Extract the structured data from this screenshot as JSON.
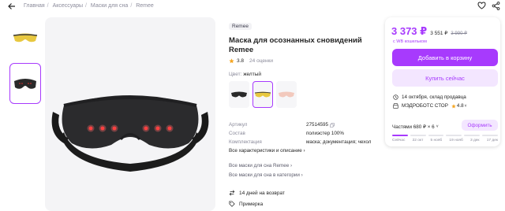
{
  "breadcrumbs": [
    "Главная",
    "Аксессуары",
    "Маски для сна",
    "Remee"
  ],
  "product": {
    "brand": "Remee",
    "title": "Маска для осознанных сновидений Remee",
    "rating": "3.8",
    "reviews": "24 оценки",
    "color_label": "Цвет:",
    "color_value": "желтый"
  },
  "specs": [
    {
      "key": "Артикул",
      "value": "27514595"
    },
    {
      "key": "Состав",
      "value": "полиэстер 100%"
    },
    {
      "key": "Комплектация",
      "value": "маска; документация; чехол"
    }
  ],
  "all_specs_label": "Все характеристики и описание",
  "links": [
    "Все маски для сна Remee",
    "Все маски для сна в категории"
  ],
  "return_label": "14 дней на возврат",
  "fitting_label": "Примерка",
  "card": {
    "price": "3 373 ₽",
    "price_old": "3 551 ₽",
    "price_strike": "3 990 ₽",
    "wallet_note": "с WB кошельком",
    "cart_button": "Добавить в корзину",
    "buy_button": "Купить сейчас",
    "delivery": "14 октября, склад продавца",
    "seller_name": "МЭДРОБОТС СТОР",
    "seller_rating": "4.8",
    "installment": "Частями 680 ₽ × 6",
    "installment_button": "Оформить",
    "installment_dates": [
      "Сейчас",
      "22 окт",
      "5 нояб",
      "19 нояб",
      "3 дек",
      "17 дек"
    ],
    "installment_paid_segments": 1
  },
  "colors": {
    "accent": "#a73afd",
    "accent_light": "#f3e6ff",
    "star": "#f5a623"
  }
}
